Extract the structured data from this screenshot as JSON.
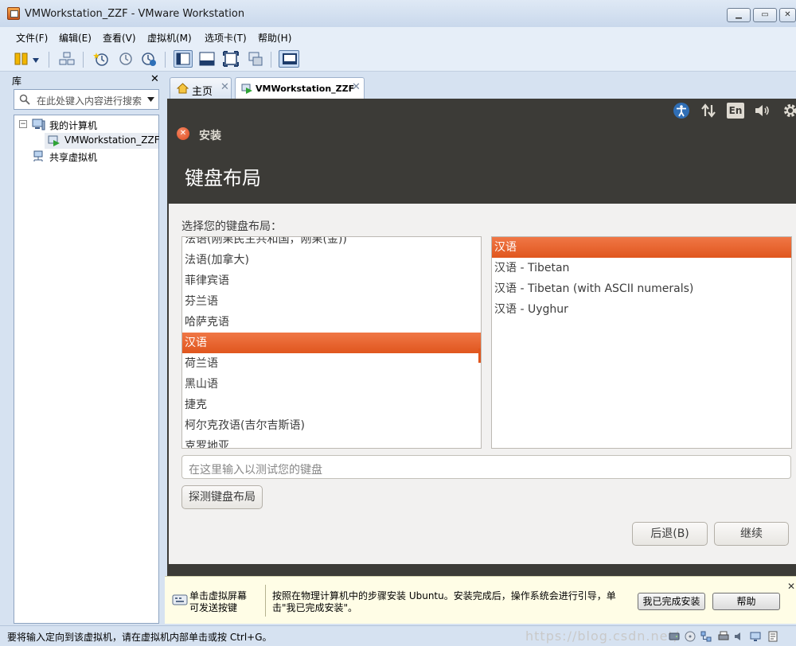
{
  "window": {
    "title": "VMWorkstation_ZZF - VMware Workstation"
  },
  "menu": [
    "文件(F)",
    "编辑(E)",
    "查看(V)",
    "虚拟机(M)",
    "选项卡(T)",
    "帮助(H)"
  ],
  "library": {
    "title": "库",
    "search_placeholder": "在此处键入内容进行搜索",
    "tree": {
      "my_computer": "我的计算机",
      "vm": "VMWorkstation_ZZF",
      "shared": "共享虚拟机"
    }
  },
  "tabs": [
    {
      "label": "主页"
    },
    {
      "label": "VMWorkstation_ZZF"
    }
  ],
  "ubuntu": {
    "indicator_lang": "En",
    "window_title": "安装",
    "heading": "键盘布局",
    "choose_label": "选择您的键盘布局：",
    "layouts": [
      "法语(刚果民主共和国，刚果(金))",
      "法语(加拿大)",
      "菲律宾语",
      "芬兰语",
      "哈萨克语",
      "汉语",
      "荷兰语",
      "黑山语",
      "捷克",
      "柯尔克孜语(吉尔吉斯语)",
      "克罗地亚"
    ],
    "selected_layout_index": 5,
    "variants": [
      "汉语",
      "汉语 - Tibetan",
      "汉语 - Tibetan (with ASCII numerals)",
      "汉语 - Uyghur"
    ],
    "selected_variant_index": 0,
    "test_placeholder": "在这里输入以测试您的键盘",
    "detect_button": "探测键盘布局",
    "back_button": "后退(B)",
    "continue_button": "继续"
  },
  "infobar": {
    "hint": "单击虚拟屏幕\n可发送按键",
    "message": "按照在物理计算机中的步骤安装 Ubuntu。安装完成后，操作系统会进行引导，单击\"我已完成安装\"。",
    "done_button": "我已完成安装",
    "help_button": "帮助"
  },
  "status": {
    "text": "要将输入定向到该虚拟机，请在虚拟机内部单击或按 Ctrl+G。",
    "watermark": "https://blog.csdn.net/"
  },
  "colors": {
    "ubuntu_orange": "#e95420",
    "ubuntu_dark": "#3c3b37",
    "vmware_chrome": "#d6e2f1"
  }
}
